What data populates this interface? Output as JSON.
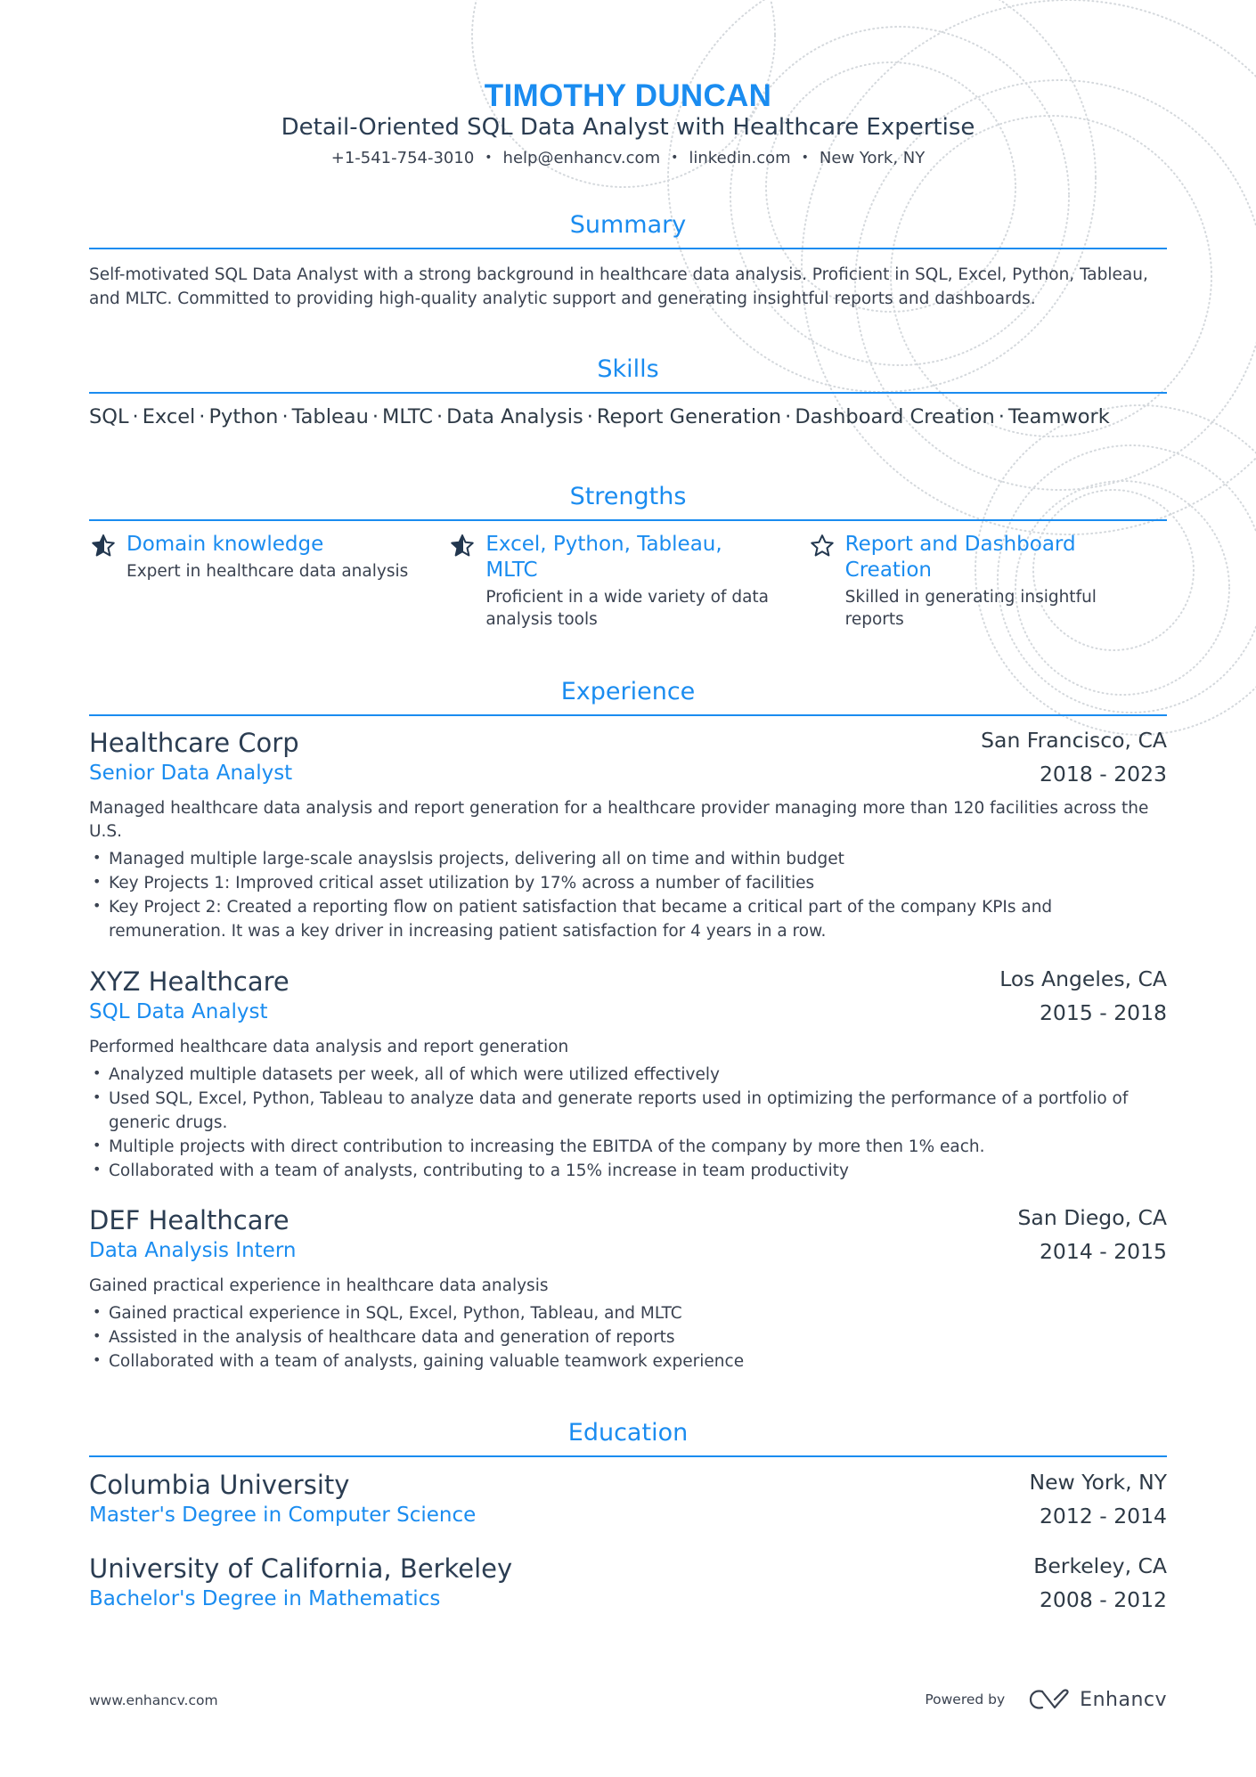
{
  "header": {
    "name": "TIMOTHY DUNCAN",
    "headline": "Detail-Oriented SQL Data Analyst with Healthcare Expertise",
    "contact": {
      "phone": "+1-541-754-3010",
      "email": "help@enhancv.com",
      "linkedin": "linkedin.com",
      "location": "New York, NY",
      "separator": "•"
    }
  },
  "sections": {
    "summary": "Summary",
    "skills": "Skills",
    "strengths": "Strengths",
    "experience": "Experience",
    "education": "Education"
  },
  "summary": {
    "text": "Self-motivated SQL Data Analyst with a strong background in healthcare data analysis. Proficient in SQL, Excel, Python, Tableau, and MLTC. Committed to providing high-quality analytic support and generating insightful reports and dashboards."
  },
  "skills": {
    "separator": "·",
    "items": [
      "SQL",
      "Excel",
      "Python",
      "Tableau",
      "MLTC",
      "Data Analysis",
      "Report Generation",
      "Dashboard Creation",
      "Teamwork"
    ]
  },
  "strengths": [
    {
      "icon": "star-half-icon",
      "title": "Domain knowledge",
      "description": "Expert in healthcare data analysis"
    },
    {
      "icon": "star-half-icon",
      "title": "Excel, Python, Tableau, MLTC",
      "description": "Proficient in a wide variety of data analysis tools"
    },
    {
      "icon": "star-outline-icon",
      "title": "Report and Dashboard Creation",
      "description": "Skilled in generating insightful reports"
    }
  ],
  "experience": [
    {
      "company": "Healthcare Corp",
      "location": "San Francisco, CA",
      "role": "Senior Data Analyst",
      "dates": "2018 - 2023",
      "description": "Managed healthcare data analysis and report generation for a healthcare provider managing more than 120 facilities across the U.S.",
      "bullets": [
        "Managed multiple large-scale anayslsis projects, delivering all on time and within budget",
        "Key Projects 1: Improved critical asset utilization by 17% across a number of facilities",
        "Key Project 2: Created a reporting flow on patient satisfaction that became a critical part of the company KPIs and remuneration. It was a key driver in increasing patient satisfaction for 4 years in a row."
      ]
    },
    {
      "company": "XYZ Healthcare",
      "location": "Los Angeles, CA",
      "role": "SQL Data Analyst",
      "dates": "2015 - 2018",
      "description": "Performed healthcare data analysis and report generation",
      "bullets": [
        "Analyzed multiple datasets per week, all of which were utilized effectively",
        "Used SQL, Excel, Python, Tableau to analyze data and generate reports used in optimizing the performance of a portfolio of generic drugs.",
        "Multiple projects with direct contribution to increasing the EBITDA of the company by more then 1% each.",
        "Collaborated with a team of analysts, contributing to a 15% increase in team productivity"
      ]
    },
    {
      "company": "DEF Healthcare",
      "location": "San Diego, CA",
      "role": "Data Analysis Intern",
      "dates": "2014 - 2015",
      "description": "Gained practical experience in healthcare data analysis",
      "bullets": [
        "Gained practical experience in SQL, Excel, Python, Tableau, and MLTC",
        "Assisted in the analysis of healthcare data and generation of reports",
        "Collaborated with a team of analysts, gaining valuable teamwork experience"
      ]
    }
  ],
  "education": [
    {
      "school": "Columbia University",
      "location": "New York, NY",
      "degree": "Master's Degree in Computer Science",
      "dates": "2012 - 2014"
    },
    {
      "school": "University of California, Berkeley",
      "location": "Berkeley, CA",
      "degree": "Bachelor's Degree in Mathematics",
      "dates": "2008 - 2012"
    }
  ],
  "footer": {
    "website": "www.enhancv.com",
    "powered_by": "Powered by",
    "brand": "Enhancv"
  },
  "colors": {
    "accent": "#1a8cf0",
    "heading_text": "#2b3d52",
    "body_text": "#3a4250",
    "icon_dark": "#22374f"
  }
}
